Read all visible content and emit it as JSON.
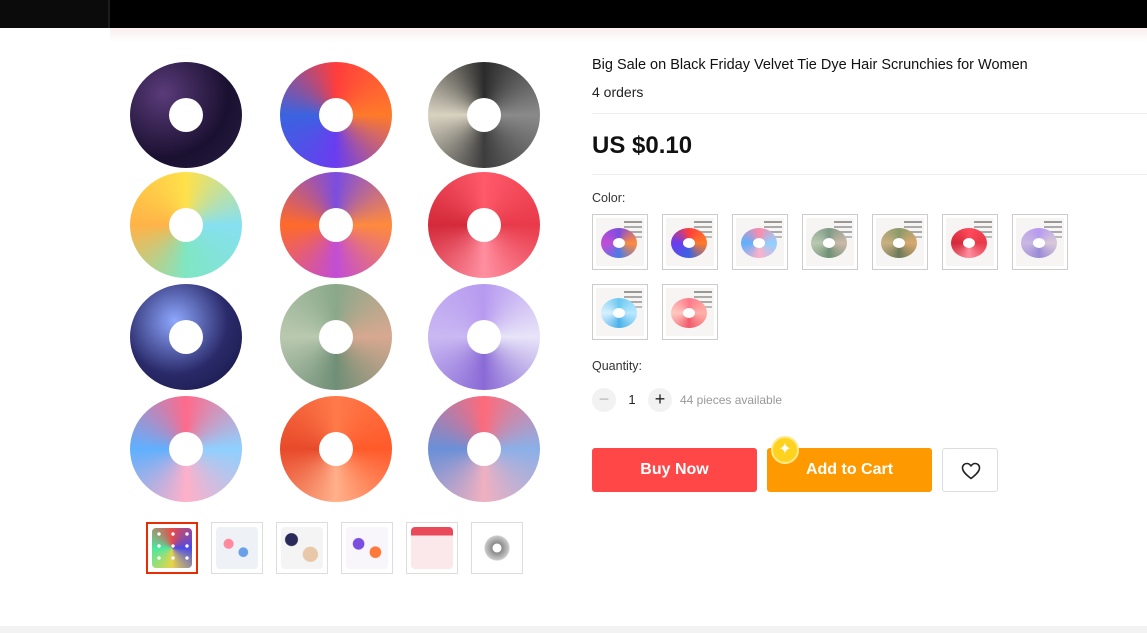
{
  "product": {
    "title": "Big Sale on Black Friday Velvet Tie Dye Hair Scrunchies for Women",
    "orders": "4 orders",
    "price": "US $0.10"
  },
  "color": {
    "label": "Color:",
    "options": [
      {
        "name": "purple-orange-blue"
      },
      {
        "name": "red-blue"
      },
      {
        "name": "pink-blue"
      },
      {
        "name": "green-gray"
      },
      {
        "name": "olive-tan"
      },
      {
        "name": "red-pink"
      },
      {
        "name": "lavender-gray"
      },
      {
        "name": "sky-blue"
      },
      {
        "name": "coral-pink"
      }
    ]
  },
  "quantity": {
    "label": "Quantity:",
    "minus": "−",
    "plus": "+",
    "value": "1",
    "available": "44 pieces available"
  },
  "actions": {
    "buy_now": "Buy Now",
    "add_to_cart": "Add to Cart",
    "wishlist_icon": "heart-icon",
    "coin_icon": "sparkle-coin-icon",
    "coin_glyph": "✦"
  },
  "gallery": {
    "thumbnail_count": 6,
    "active_thumbnail": 1
  },
  "colors": {
    "buy_now": "#ff4747",
    "add_to_cart": "#ff9900",
    "active_thumb_border": "#e62e04"
  }
}
